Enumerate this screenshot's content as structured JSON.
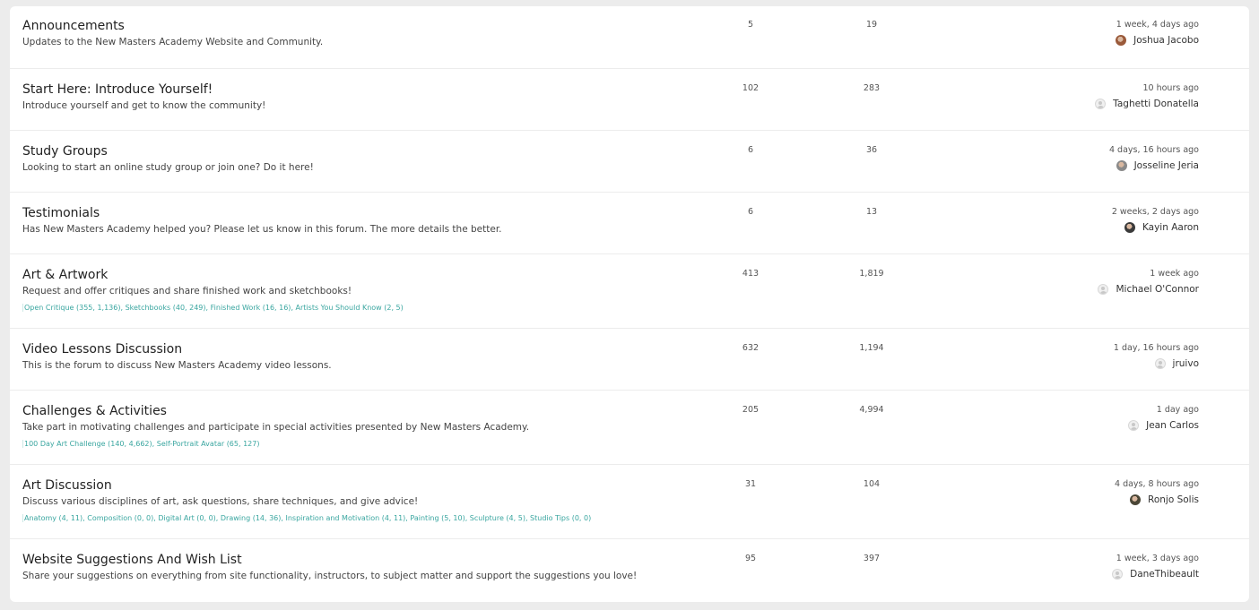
{
  "forums": [
    {
      "title": "Announcements",
      "description": "Updates to the New Masters Academy Website and Community.",
      "subforums": [],
      "topics": "5",
      "posts": "19",
      "last_time": "1 week, 4 days ago",
      "last_user": "Joshua Jacobo",
      "avatar_color": "#9a5a3a"
    },
    {
      "title": "Start Here: Introduce Yourself!",
      "description": "Introduce yourself and get to know the community!",
      "subforums": [],
      "topics": "102",
      "posts": "283",
      "last_time": "10 hours ago",
      "last_user": "Taghetti Donatella",
      "avatar_color": "placeholder"
    },
    {
      "title": "Study Groups",
      "description": "Looking to start an online study group or join one? Do it here!",
      "subforums": [],
      "topics": "6",
      "posts": "36",
      "last_time": "4 days, 16 hours ago",
      "last_user": "Josseline Jeria",
      "avatar_color": "#8a8a8a"
    },
    {
      "title": "Testimonials",
      "description": "Has New Masters Academy helped you? Please let us know in this forum. The more details the better.",
      "subforums": [],
      "topics": "6",
      "posts": "13",
      "last_time": "2 weeks, 2 days ago",
      "last_user": "Kayin Aaron",
      "avatar_color": "#3a3a3a"
    },
    {
      "title": "Art & Artwork",
      "description": "Request and offer critiques and share finished work and sketchbooks!",
      "subforums": [
        "Open Critique (355, 1,136)",
        "Sketchbooks (40, 249)",
        "Finished Work (16, 16)",
        "Artists You Should Know (2, 5)"
      ],
      "topics": "413",
      "posts": "1,819",
      "last_time": "1 week ago",
      "last_user": "Michael O'Connor",
      "avatar_color": "placeholder"
    },
    {
      "title": "Video Lessons Discussion",
      "description": "This is the forum to discuss New Masters Academy video lessons.",
      "subforums": [],
      "topics": "632",
      "posts": "1,194",
      "last_time": "1 day, 16 hours ago",
      "last_user": "jruivo",
      "avatar_color": "placeholder"
    },
    {
      "title": "Challenges & Activities",
      "description": "Take part in motivating challenges and participate in special activities presented by New Masters Academy.",
      "subforums": [
        "100 Day Art Challenge (140, 4,662)",
        "Self-Portrait Avatar (65, 127)"
      ],
      "topics": "205",
      "posts": "4,994",
      "last_time": "1 day ago",
      "last_user": "Jean Carlos",
      "avatar_color": "placeholder"
    },
    {
      "title": "Art Discussion",
      "description": "Discuss various disciplines of art, ask questions, share techniques, and give advice!",
      "subforums": [
        "Anatomy (4, 11)",
        "Composition (0, 0)",
        "Digital Art (0, 0)",
        "Drawing (14, 36)",
        "Inspiration and Motivation (4, 11)",
        "Painting (5, 10)",
        "Sculpture (4, 5)",
        "Studio Tips (0, 0)"
      ],
      "topics": "31",
      "posts": "104",
      "last_time": "4 days, 8 hours ago",
      "last_user": "Ronjo Solis",
      "avatar_color": "#4a4636"
    },
    {
      "title": "Website Suggestions And Wish List",
      "description": "Share your suggestions on everything from site functionality, instructors, to subject matter and support the suggestions you love!",
      "subforums": [],
      "topics": "95",
      "posts": "397",
      "last_time": "1 week, 3 days ago",
      "last_user": "DaneThibeault",
      "avatar_color": "placeholder"
    }
  ]
}
